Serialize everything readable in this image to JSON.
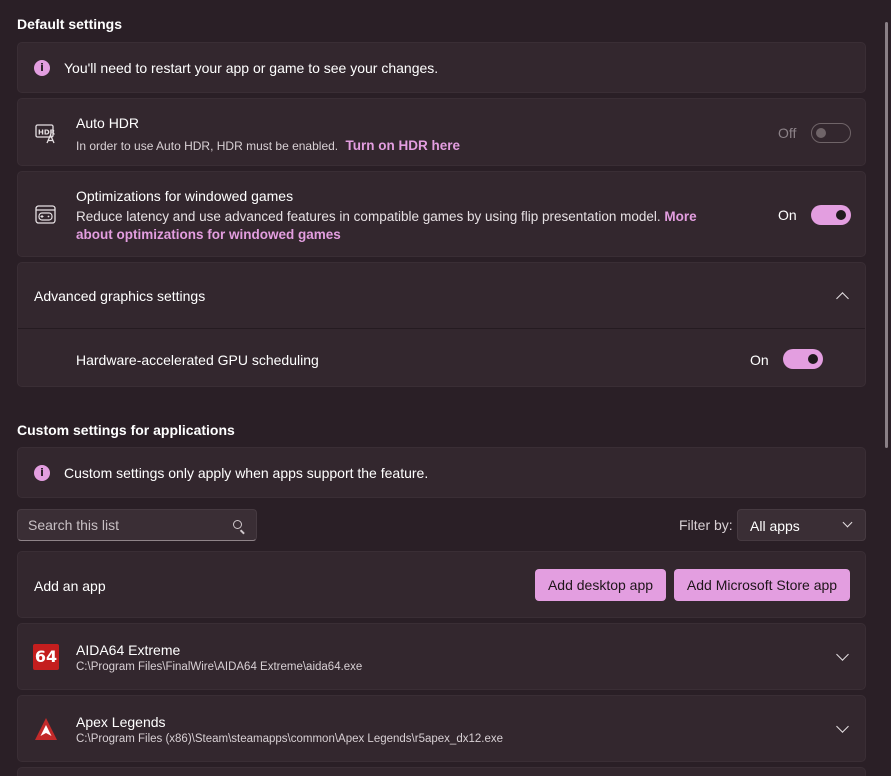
{
  "default_settings": {
    "title": "Default settings",
    "restart_notice": "You'll need to restart your app or game to see your changes.",
    "auto_hdr": {
      "title": "Auto HDR",
      "description": "In order to use Auto HDR, HDR must be enabled.",
      "link": "Turn on HDR here",
      "state_label": "Off",
      "enabled": false
    },
    "windowed_opt": {
      "title": "Optimizations for windowed games",
      "description": "Reduce latency and use advanced features in compatible games by using flip presentation model.",
      "link_part1": "More",
      "link_part2": "about optimizations for windowed games",
      "state_label": "On",
      "enabled": true
    },
    "advanced": {
      "title": "Advanced graphics settings",
      "gpu_scheduling": {
        "title": "Hardware-accelerated GPU scheduling",
        "state_label": "On",
        "enabled": true
      }
    }
  },
  "custom_settings": {
    "title": "Custom settings for applications",
    "notice": "Custom settings only apply when apps support the feature.",
    "search_placeholder": "Search this list",
    "filter_label": "Filter by:",
    "filter_value": "All apps",
    "add_app_label": "Add an app",
    "add_desktop_button": "Add desktop app",
    "add_store_button": "Add Microsoft Store app",
    "apps": [
      {
        "name": "AIDA64 Extreme",
        "path": "C:\\Program Files\\FinalWire\\AIDA64 Extreme\\aida64.exe",
        "icon_text": "64"
      },
      {
        "name": "Apex Legends",
        "path": "C:\\Program Files (x86)\\Steam\\steamapps\\common\\Apex Legends\\r5apex_dx12.exe",
        "icon_text": ""
      }
    ]
  },
  "colors": {
    "accent": "#e39ee0",
    "background": "#2a1f26",
    "card": "#33272e"
  },
  "icons": {
    "info": "info-icon",
    "hdr": "hdr-icon",
    "windowed": "windowed-games-icon",
    "chevron": "chevron-icon",
    "search": "search-icon"
  }
}
